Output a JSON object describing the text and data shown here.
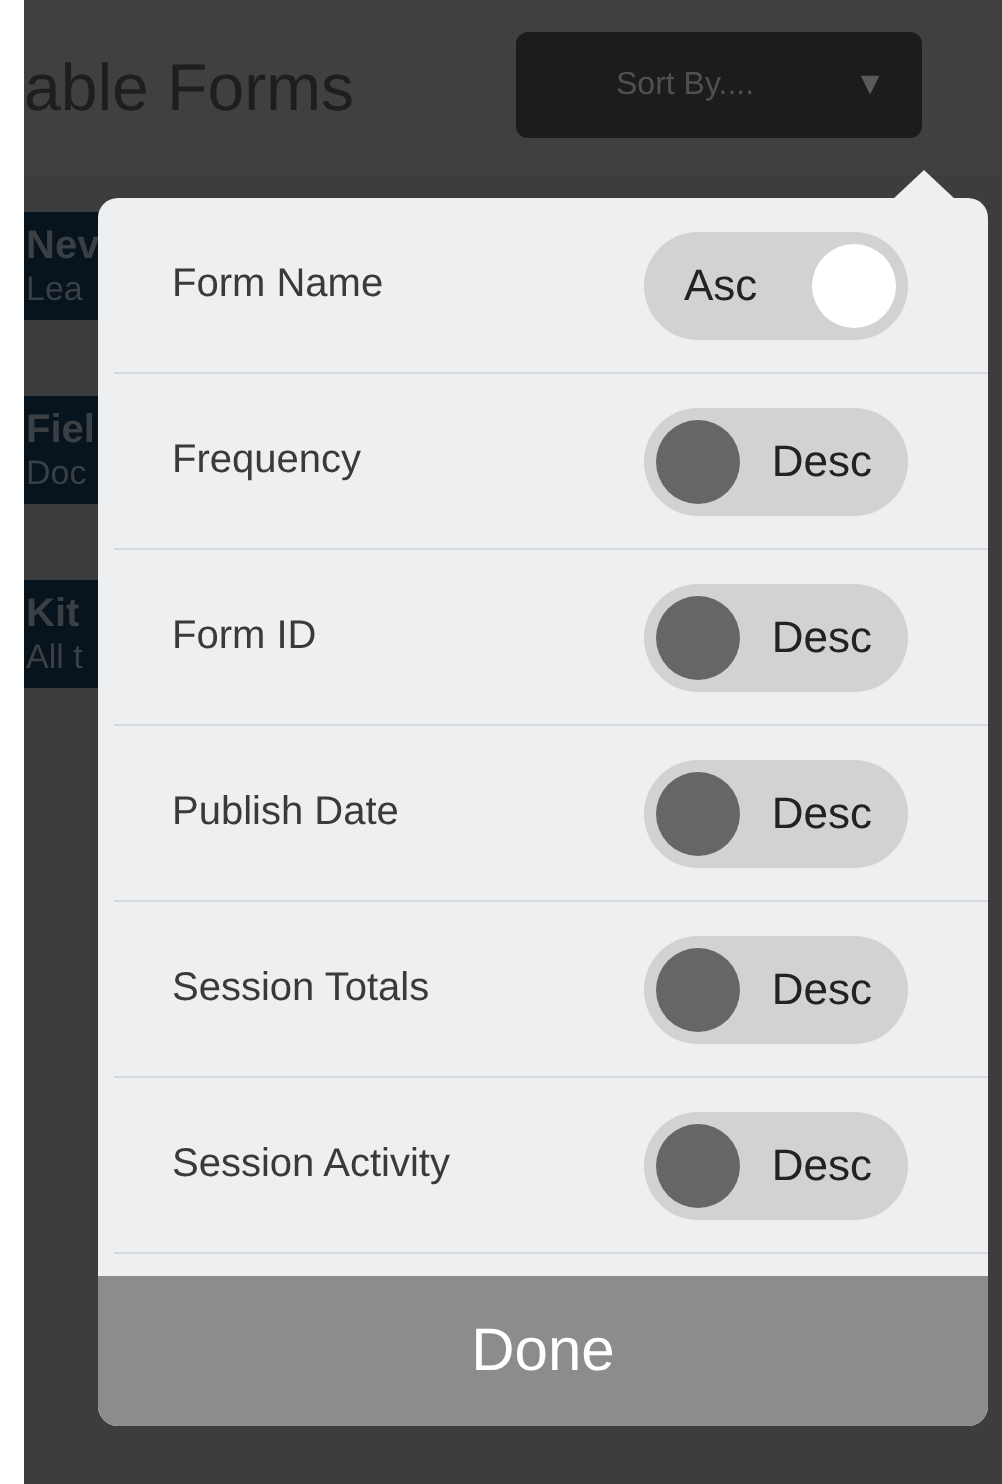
{
  "header": {
    "title": "able Forms",
    "sort_button": {
      "label": "Sort By....",
      "icon": "▼"
    }
  },
  "forms": [
    {
      "name": "Nev",
      "detail": "Lea"
    },
    {
      "name": "Fiel",
      "detail": "Doc"
    },
    {
      "name": "Kit",
      "detail": "All t"
    }
  ],
  "sort_popup": {
    "options": [
      {
        "label": "Form Name",
        "on": true,
        "toggle_label": "Asc"
      },
      {
        "label": "Frequency",
        "on": false,
        "toggle_label": "Desc"
      },
      {
        "label": "Form ID",
        "on": false,
        "toggle_label": "Desc"
      },
      {
        "label": "Publish Date",
        "on": false,
        "toggle_label": "Desc"
      },
      {
        "label": "Session Totals",
        "on": false,
        "toggle_label": "Desc"
      },
      {
        "label": "Session Activity",
        "on": false,
        "toggle_label": "Desc"
      }
    ],
    "done_button": "Done"
  }
}
